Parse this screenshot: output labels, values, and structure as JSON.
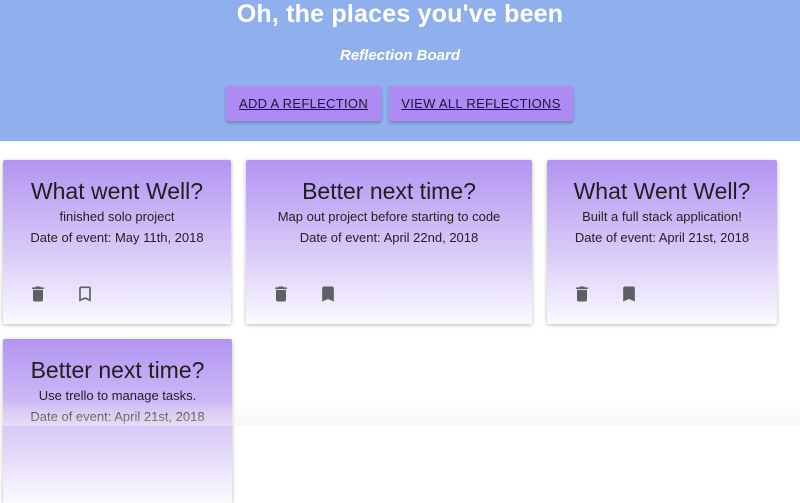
{
  "header": {
    "title": "Oh, the places you've been",
    "subtitle": "Reflection Board",
    "buttons": {
      "add_label": "ADD A REFLECTION",
      "view_label": "VIEW ALL REFLECTIONS"
    },
    "background_color": "#8fb0ec",
    "button_color": "#ad8bf3"
  },
  "cards": [
    {
      "title": "What went Well?",
      "description": "finished solo project",
      "date": "Date of event: May 11th, 2018",
      "bookmarked": false
    },
    {
      "title": "Better next time?",
      "description": "Map out project before starting to code",
      "date": "Date of event: April 22nd, 2018",
      "bookmarked": true
    },
    {
      "title": "What Went Well?",
      "description": "Built a full stack application!",
      "date": "Date of event: April 21st, 2018",
      "bookmarked": true
    },
    {
      "title": "Better next time?",
      "description": "Use trello to manage tasks.",
      "date": "Date of event: April 21st, 2018",
      "bookmarked": null
    }
  ],
  "icons": {
    "delete": "trash-icon",
    "bookmark_outline": "bookmark-outline-icon",
    "bookmark_filled": "bookmark-icon"
  }
}
